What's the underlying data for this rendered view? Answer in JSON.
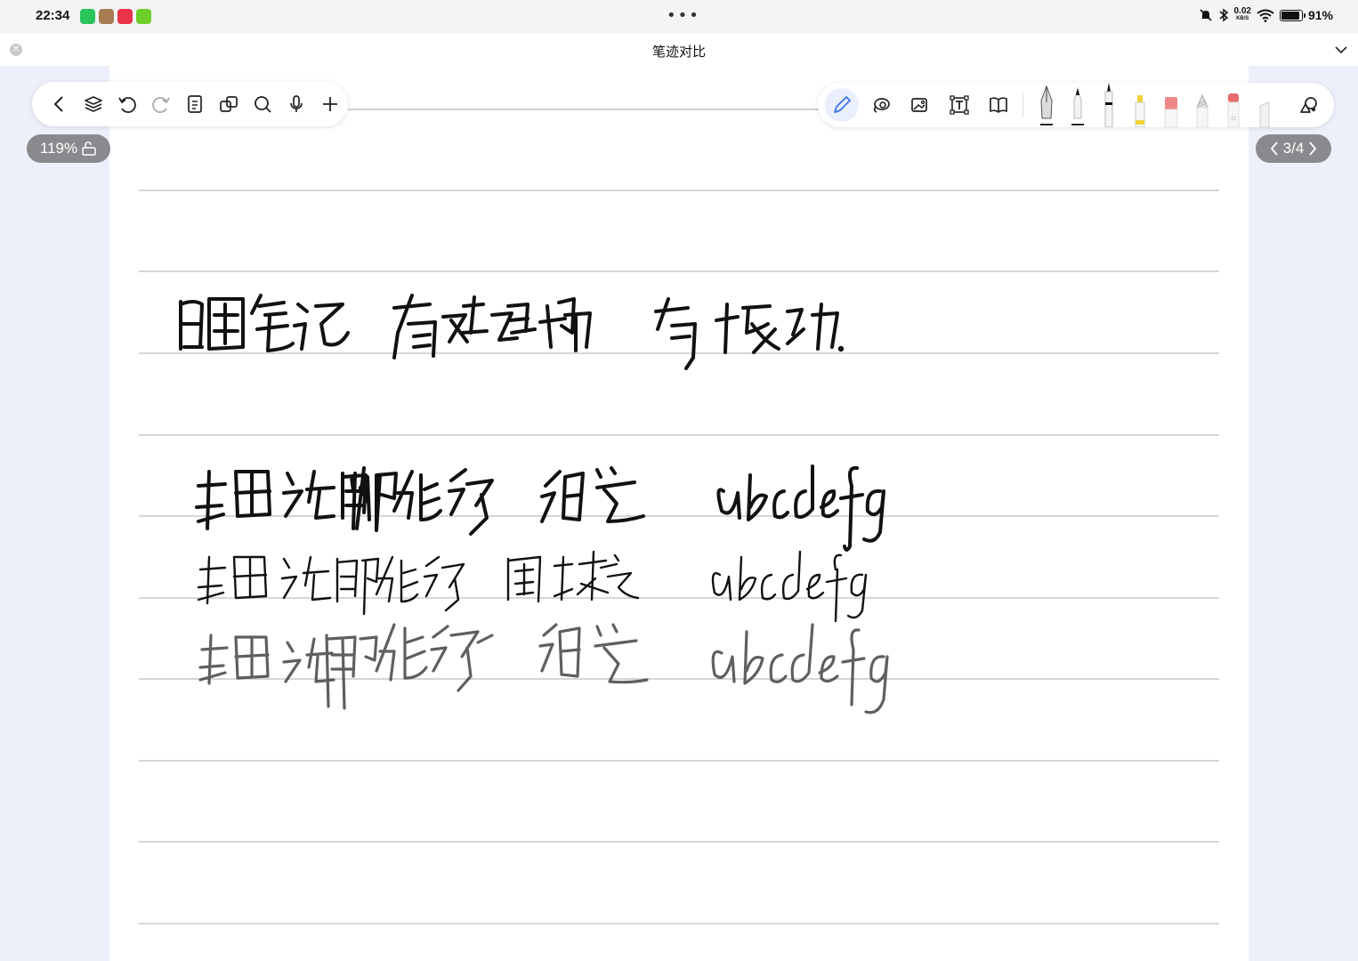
{
  "status_bar": {
    "time": "22:34",
    "net_speed_value": "0.02",
    "net_speed_unit": "KB/S",
    "battery": "91%",
    "battery_level": 0.91,
    "more_dots": "•••"
  },
  "window": {
    "title": "笔迹对比"
  },
  "zoom": {
    "label": "119%"
  },
  "pager": {
    "label": "3/4"
  },
  "toolbar_left": [
    "back-icon",
    "layers-icon",
    "undo-icon",
    "redo-icon",
    "outline-icon",
    "copy-icon",
    "search-icon",
    "microphone-icon",
    "add-icon"
  ],
  "toolbar_right": [
    "pen-mode-icon",
    "lasso-icon",
    "image-icon",
    "text-box-icon",
    "book-icon"
  ],
  "pens": [
    {
      "name": "fountain-pen",
      "color": "#222222"
    },
    {
      "name": "ballpoint-pen",
      "color": "#111111"
    },
    {
      "name": "fineliner",
      "color": "#111111"
    },
    {
      "name": "highlighter",
      "color": "#f3d33a"
    },
    {
      "name": "marker-pink",
      "color": "#ee8888"
    },
    {
      "name": "pencil",
      "color": "#aaaaaa"
    },
    {
      "name": "eraser",
      "color": "#e86b6b"
    },
    {
      "name": "ruler",
      "color": "#f2f2f2"
    }
  ],
  "colors": {
    "accent": "#3a76e8",
    "page": "#ffffff",
    "background": "#edf0fb",
    "ink": "#111111"
  }
}
